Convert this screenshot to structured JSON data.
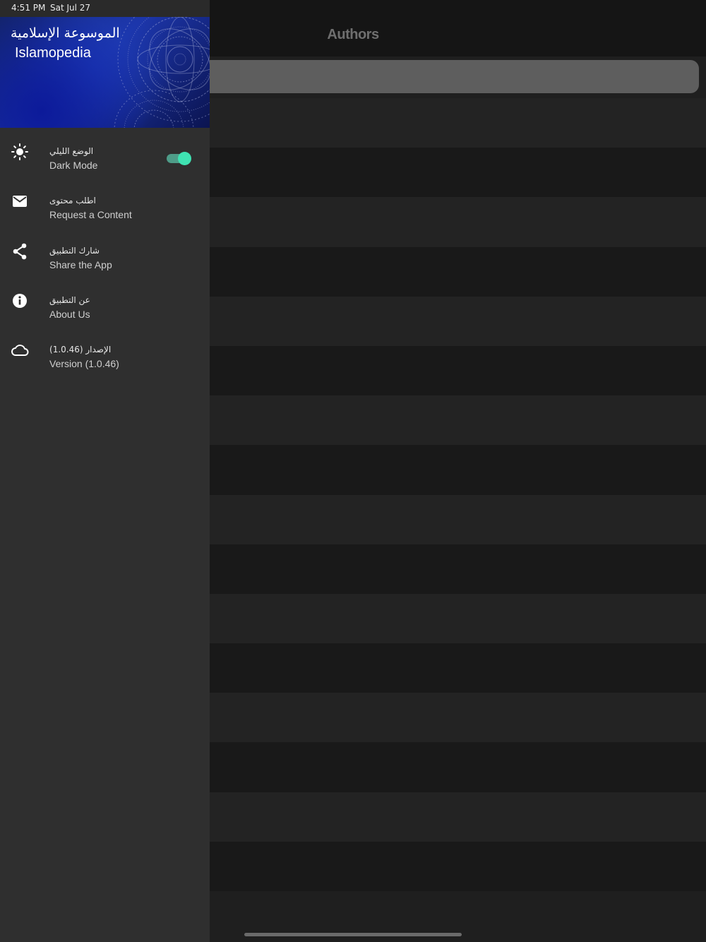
{
  "status_bar": {
    "time": "4:51 PM",
    "date": "Sat Jul 27"
  },
  "main": {
    "title": "Authors",
    "search": {
      "placeholder": ""
    }
  },
  "drawer": {
    "header": {
      "title_ar": "الموسوعة الإسلامية",
      "title_en": "Islamopedia"
    },
    "items": [
      {
        "icon": "sun-icon",
        "label_ar": "الوضع الليلي",
        "label_en": "Dark Mode",
        "toggle": true
      },
      {
        "icon": "envelope-icon",
        "label_ar": "اطلب محتوى",
        "label_en": "Request a Content"
      },
      {
        "icon": "share-icon",
        "label_ar": "شارك التطبيق",
        "label_en": "Share the App"
      },
      {
        "icon": "info-icon",
        "label_ar": "عن التطبيق",
        "label_en": "About Us"
      },
      {
        "icon": "cloud-icon",
        "label_ar": "الإصدار (1.0.46)",
        "label_en": "Version (1.0.46)"
      }
    ]
  },
  "colors": {
    "drawer_bg": "#2f2f2f",
    "toggle_on": "#3fe2b2",
    "header_blue": "#1c35a8"
  }
}
